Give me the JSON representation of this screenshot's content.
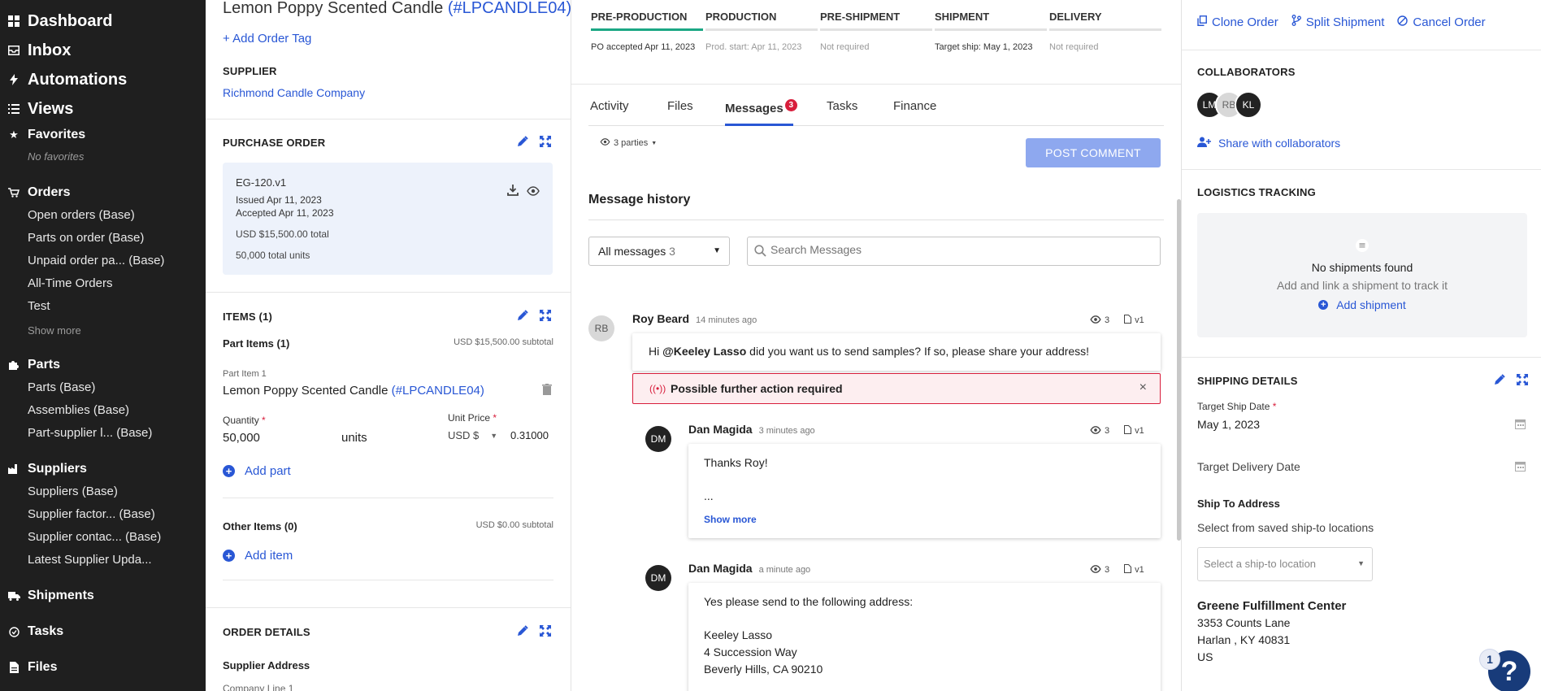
{
  "nav": {
    "dashboard": "Dashboard",
    "inbox": "Inbox",
    "automations": "Automations",
    "views": "Views",
    "favorites": "Favorites",
    "no_favorites": "No favorites",
    "orders": "Orders",
    "orders_items": [
      "Open orders (Base)",
      "Parts on order (Base)",
      "Unpaid order pa... (Base)",
      "All-Time Orders",
      "Test"
    ],
    "show_more": "Show more",
    "parts": "Parts",
    "parts_items": [
      "Parts (Base)",
      "Assemblies (Base)",
      "Part-supplier l... (Base)"
    ],
    "suppliers": "Suppliers",
    "suppliers_items": [
      "Suppliers (Base)",
      "Supplier factor... (Base)",
      "Supplier contac... (Base)",
      "Latest Supplier Upda..."
    ],
    "shipments": "Shipments",
    "tasks": "Tasks",
    "files": "Files"
  },
  "order": {
    "title": "Lemon Poppy Scented Candle",
    "ref": "(#LPCANDLE04)",
    "add_tag": "+ Add Order Tag",
    "supplier_label": "SUPPLIER",
    "supplier_name": "Richmond Candle Company"
  },
  "purchase_order": {
    "label": "PURCHASE ORDER",
    "doc": "EG-120.v1",
    "issued": "Issued Apr 11, 2023",
    "accepted": "Accepted Apr 11, 2023",
    "total": "USD $15,500.00 total",
    "units": "50,000 total units"
  },
  "items": {
    "label": "ITEMS (1)",
    "part_items": "Part Items (1)",
    "part_subtotal": "USD $15,500.00 subtotal",
    "part_item_label": "Part Item 1",
    "part_name": "Lemon Poppy Scented Candle",
    "part_ref": "(#LPCANDLE04)",
    "quantity_label": "Quantity",
    "quantity_value": "50,000",
    "quantity_unit": "units",
    "unit_price_label": "Unit Price",
    "currency": "USD $",
    "unit_price_value": "0.31000",
    "add_part": "Add part",
    "other_items": "Other Items (0)",
    "other_subtotal": "USD $0.00 subtotal",
    "add_item": "Add item"
  },
  "order_details": {
    "label": "ORDER DETAILS",
    "supplier_address": "Supplier Address",
    "company_line": "Company Line 1"
  },
  "stages": [
    {
      "name": "PRE-PRODUCTION",
      "status": "PO accepted Apr 11, 2023",
      "active": true
    },
    {
      "name": "PRODUCTION",
      "status": "Prod. start: Apr 11, 2023",
      "active": false
    },
    {
      "name": "PRE-SHIPMENT",
      "status": "Not required",
      "active": false
    },
    {
      "name": "SHIPMENT",
      "status": "Target ship: May 1, 2023",
      "active": false
    },
    {
      "name": "DELIVERY",
      "status": "Not required",
      "active": false
    }
  ],
  "tabs": {
    "activity": "Activity",
    "files": "Files",
    "messages": "Messages",
    "messages_count": "3",
    "tasks": "Tasks",
    "finance": "Finance"
  },
  "composer": {
    "parties": "3 parties",
    "post_button": "POST COMMENT"
  },
  "history": {
    "title": "Message history",
    "filter_label": "All messages",
    "filter_count": "3",
    "search_placeholder": "Search Messages"
  },
  "messages": [
    {
      "initials": "RB",
      "author": "Roy Beard",
      "time": "14 minutes ago",
      "views": "3",
      "version": "v1",
      "mention": "@Keeley Lasso",
      "text_before": "Hi ",
      "text_after": " did you want us to send samples? If so, please share your address!",
      "alert": "Possible further action required"
    },
    {
      "initials": "DM",
      "author": "Dan Magida",
      "time": "3 minutes ago",
      "views": "3",
      "version": "v1",
      "line1": "Thanks Roy!",
      "line2": "...",
      "show_more": "Show more"
    },
    {
      "initials": "DM",
      "author": "Dan Magida",
      "time": "a minute ago",
      "views": "3",
      "version": "v1",
      "lines": [
        "Yes please send to the following address:",
        "Keeley Lasso",
        "4 Succession Way",
        "Beverly Hills, CA 90210"
      ]
    }
  ],
  "sidebar": {
    "clone": "Clone Order",
    "split": "Split Shipment",
    "cancel": "Cancel Order",
    "collaborators_label": "COLLABORATORS",
    "collaborators": [
      "LM",
      "RB",
      "KL"
    ],
    "share": "Share with collaborators",
    "logistics_label": "LOGISTICS TRACKING",
    "no_shipments": "No shipments found",
    "no_shipments_hint": "Add and link a shipment to track it",
    "add_shipment": "Add shipment",
    "shipping_label": "SHIPPING DETAILS",
    "target_ship_label": "Target Ship Date",
    "target_ship_value": "May 1, 2023",
    "target_delivery_label": "Target Delivery Date",
    "ship_to_label": "Ship To Address",
    "ship_to_hint": "Select from saved ship-to locations",
    "ship_to_placeholder": "Select a ship-to location",
    "address_name": "Greene Fulfillment Center",
    "address_line1": "3353 Counts Lane",
    "address_line2": "Harlan , KY 40831",
    "address_line3": "US",
    "help_count": "1",
    "help_glyph": "?"
  },
  "colors": {
    "accent": "#2957d5",
    "nav_bg": "#1f1f1f",
    "stage_active": "#1ba784",
    "badge": "#d81e3c",
    "help": "#183b7a"
  }
}
